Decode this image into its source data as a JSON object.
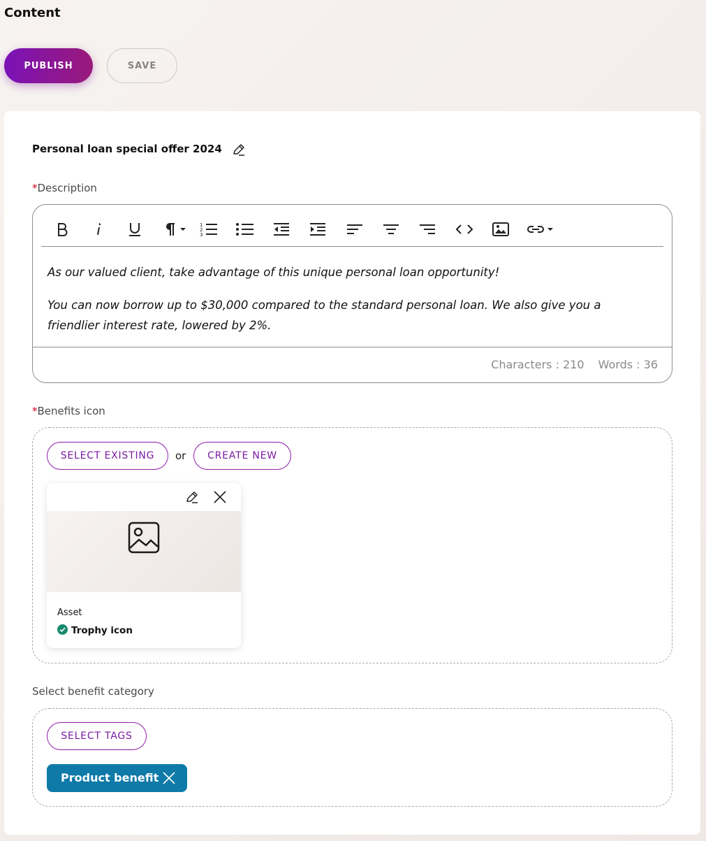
{
  "page": {
    "title": "Content"
  },
  "actions": {
    "publish_label": "PUBLISH",
    "save_label": "SAVE"
  },
  "item": {
    "title": "Personal loan special offer 2024"
  },
  "description": {
    "required_mark": "*",
    "label": "Description",
    "toolbar_icons": [
      "bold-icon",
      "italic-icon",
      "underline-icon",
      "paragraph-icon",
      "ordered-list-icon",
      "bullet-list-icon",
      "outdent-icon",
      "indent-icon",
      "align-left-icon",
      "align-center-icon",
      "align-right-icon",
      "code-icon",
      "image-icon",
      "link-icon"
    ],
    "paragraphs": [
      "As our valued client, take advantage of this unique personal loan opportunity!",
      "You can now borrow up to $30,000 compared to the standard personal loan. We also give you a friendlier interest rate, lowered by 2%."
    ],
    "characters": "Characters : 210",
    "words": "Words : 36"
  },
  "benefits_icon": {
    "required_mark": "*",
    "label": "Benefits icon",
    "select_existing": "SELECT EXISTING",
    "or": "or",
    "create_new": "CREATE NEW",
    "asset": {
      "type_label": "Asset",
      "name": "Trophy icon",
      "status_color": "#1a8a6e"
    }
  },
  "benefit_category": {
    "label": "Select benefit category",
    "select_tags": "SELECT TAGS",
    "tags": [
      {
        "label": "Product benefit"
      }
    ]
  },
  "colors": {
    "accent": "#7a12b6",
    "tag": "#0f7aa8",
    "required": "#d0021b"
  }
}
